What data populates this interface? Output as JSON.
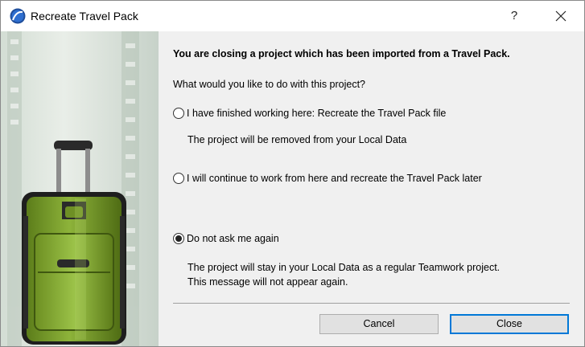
{
  "window": {
    "title": "Recreate Travel Pack",
    "help_label": "?",
    "icons": {
      "app": "archicad-icon",
      "close": "close-icon"
    }
  },
  "dialog": {
    "heading": "You are closing a project which has been imported from a Travel Pack.",
    "question": "What would you like to do with this project?",
    "options": [
      {
        "label": "I have finished working here: Recreate the Travel Pack file",
        "note": "The project will be removed from your Local Data",
        "checked": false
      },
      {
        "label": "I will continue to work from here and recreate the Travel Pack later",
        "note": "",
        "checked": false
      },
      {
        "label": "Do not ask me again",
        "note_line1": "The project will stay in your Local Data as a regular Teamwork project.",
        "note_line2": "This message will not appear again.",
        "checked": true
      }
    ],
    "buttons": {
      "cancel": "Cancel",
      "close": "Close"
    }
  },
  "colors": {
    "suitcase_green": "#7fa32a",
    "accent": "#0078d7",
    "panel_bg": "#f0f0f0"
  }
}
